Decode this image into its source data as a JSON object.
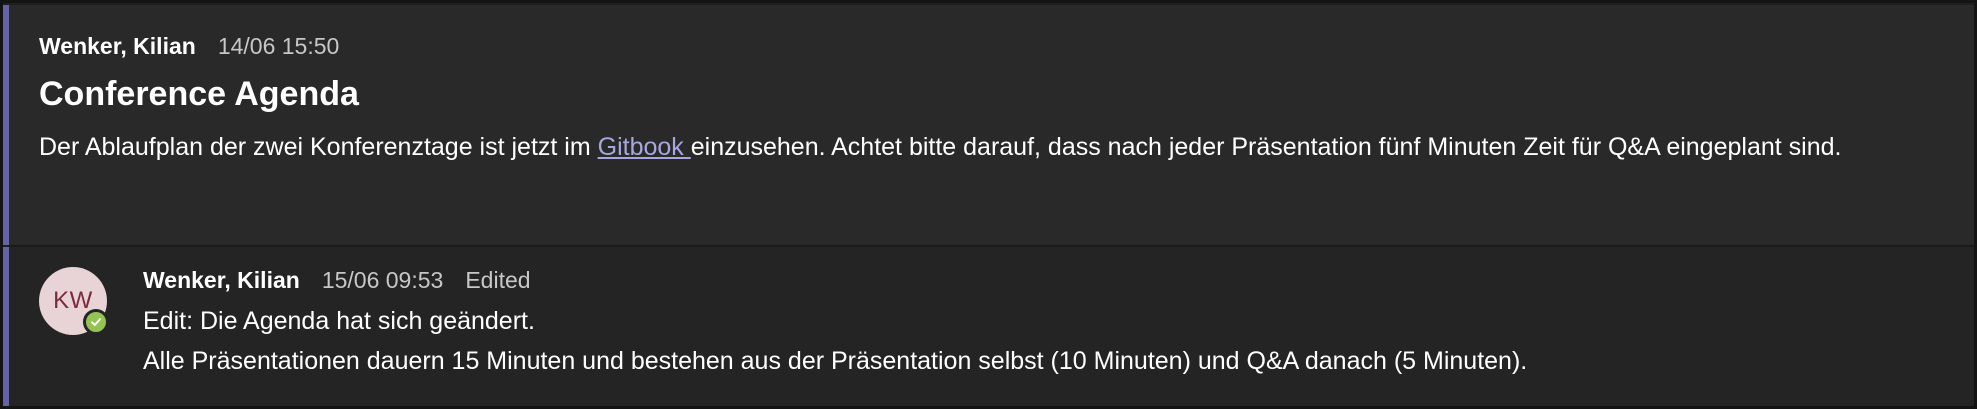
{
  "post": {
    "author": "Wenker, Kilian",
    "timestamp": "14/06 15:50",
    "title": "Conference Agenda",
    "body_before_link": "Der Ablaufplan der zwei Konferenztage ist jetzt im ",
    "link_text": "Gitbook ",
    "body_after_link": "einzusehen. Achtet bitte darauf, dass nach jeder Präsentation fünf Minuten Zeit für Q&A eingeplant sind."
  },
  "reply": {
    "avatar_initials": "KW",
    "presence_icon": "available-check-icon",
    "author": "Wenker, Kilian",
    "timestamp": "15/06 09:53",
    "edited_label": "Edited",
    "line1": "Edit: Die Agenda hat sich geändert.",
    "line2": "Alle Präsentationen dauern 15 Minuten und bestehen aus der Präsentation selbst (10 Minuten) und Q&A danach (5 Minuten)."
  },
  "colors": {
    "accent": "#6264a7",
    "link": "#a6a7dc",
    "presence_available": "#92c353",
    "avatar_bg": "#e8d3d6",
    "avatar_text": "#7d2a3c"
  }
}
